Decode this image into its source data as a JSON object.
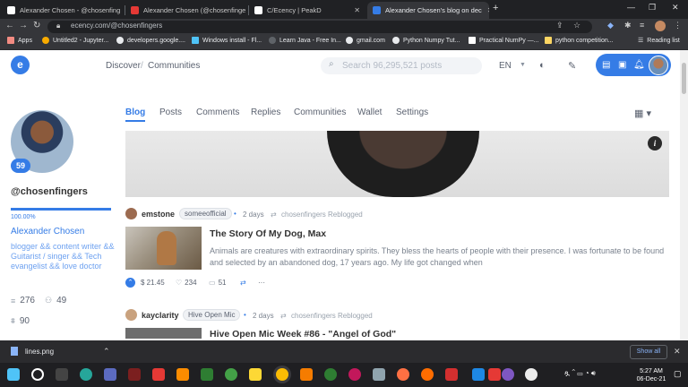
{
  "browser": {
    "tabs": [
      {
        "title": "Alexander Chosen - @chosenfing",
        "active": false,
        "color": "#ffffff"
      },
      {
        "title": "Alexander Chosen (@chosenfinge",
        "active": false,
        "color": "#e53935"
      },
      {
        "title": "C/Ecency | PeakD",
        "active": false,
        "color": "#ffffff"
      },
      {
        "title": "Alexander Chosen's blog on dec",
        "active": true,
        "color": "#357ce6"
      }
    ],
    "new_tab": "+",
    "url": "ecency.com/@chosenfingers",
    "bookmarks": [
      "Apps",
      "Untitled2 - Jupyter...",
      "developers.google....",
      "Windows install - Fl...",
      "Learn Java - Free In...",
      "gmail.com",
      "Python Numpy Tut...",
      "Practical NumPy —...",
      "python competition..."
    ],
    "reading_list": "Reading list"
  },
  "header": {
    "logo": "e",
    "breadcrumb": [
      "Discover",
      "/",
      "Communities"
    ],
    "search_placeholder": "Search 96,295,521 posts",
    "language": "EN",
    "accent_color": "#357ce6"
  },
  "profile": {
    "reputation": "59",
    "username": "@chosenfingers",
    "voting_power": "100.00%",
    "voting_power_fraction": 1.0,
    "full_name": "Alexander Chosen",
    "about": "blogger && content writer && Guitarist / singer && Tech evangelist && love doctor",
    "followers": "276",
    "following": "49",
    "posts": "90"
  },
  "tabs": [
    "Blog",
    "Posts",
    "Comments",
    "Replies",
    "Communities",
    "Wallet",
    "Settings"
  ],
  "active_tab": "Blog",
  "cover_info": "i",
  "entries": [
    {
      "author": "emstone",
      "community": "someeofficial",
      "date": "2 days",
      "reblog": "chosenfingers Reblogged",
      "title": "The Story Of My Dog, Max",
      "summary": "Animals are creatures with extraordinary spirits. They bless the hearts of people with their presence. I was fortunate to be found and selected by an abandoned dog, 17 years ago. My life got changed when",
      "payout": "$ 21.45",
      "votes": "234",
      "comments": "51",
      "more": "···"
    },
    {
      "author": "kayclarity",
      "community": "Hive Open Mic",
      "date": "2 days",
      "reblog": "chosenfingers Reblogged",
      "title": "Hive Open Mic Week #86 - \"Angel of God\""
    }
  ],
  "download": {
    "file": "lines.png",
    "show_all": "Show all"
  },
  "taskbar": {
    "time": "5:27 AM",
    "date": "06-Dec-21"
  }
}
